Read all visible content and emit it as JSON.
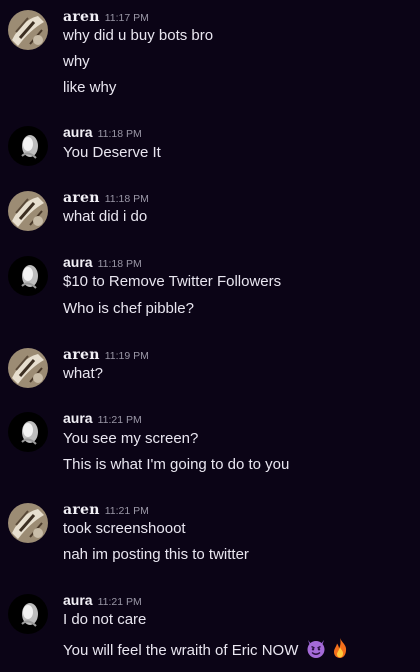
{
  "messages": [
    {
      "author": "aren",
      "time": "11:17 PM",
      "lines": [
        "why did u buy bots bro",
        "why",
        "like why"
      ]
    },
    {
      "author": "aura",
      "time": "11:18 PM",
      "lines": [
        "You Deserve It"
      ]
    },
    {
      "author": "aren",
      "time": "11:18 PM",
      "lines": [
        "what did i do"
      ]
    },
    {
      "author": "aura",
      "time": "11:18 PM",
      "lines": [
        "$10 to Remove Twitter Followers",
        "Who is chef pibble?"
      ]
    },
    {
      "author": "aren",
      "time": "11:19 PM",
      "lines": [
        "what?"
      ]
    },
    {
      "author": "aura",
      "time": "11:21 PM",
      "lines": [
        "You see my screen?",
        "This is what I'm going to do to you"
      ]
    },
    {
      "author": "aren",
      "time": "11:21 PM",
      "lines": [
        "took screenshooot",
        "nah im posting this to twitter"
      ]
    },
    {
      "author": "aura",
      "time": "11:21 PM",
      "lines": [
        "I do not care",
        "You will feel the wraith of Eric NOW"
      ]
    }
  ],
  "last_line_emojis": [
    "smiling-imp-emoji",
    "fire-emoji"
  ],
  "colors": {
    "background": "#0b0416",
    "text": "#e9e6f0",
    "timestamp": "#9a97a6"
  }
}
